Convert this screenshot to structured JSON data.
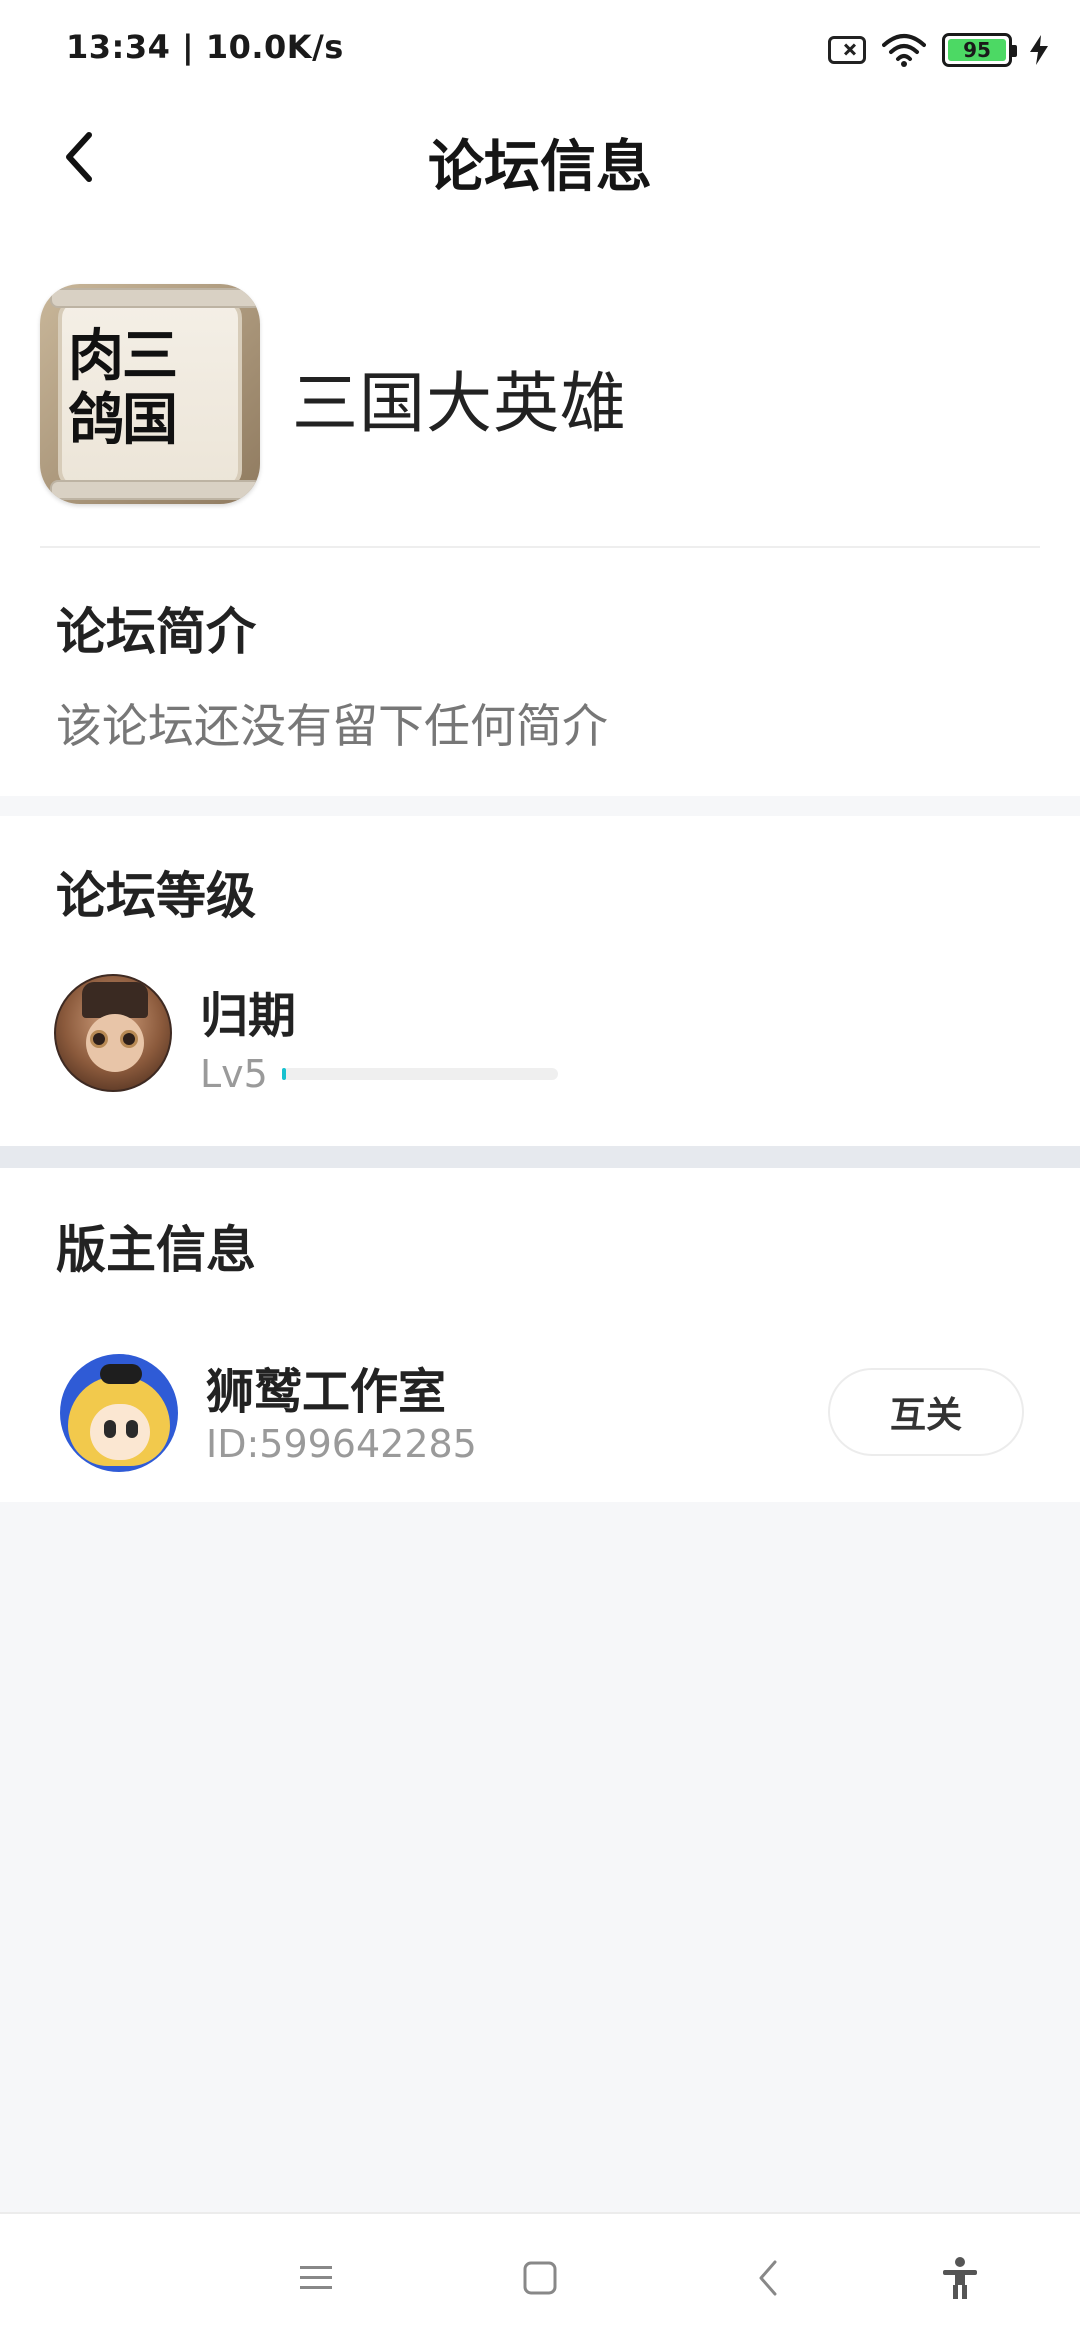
{
  "status_bar": {
    "time": "13:34 | 10.0K/s",
    "battery_level": "95",
    "icons": [
      "sim-no-signal-icon",
      "wifi-icon",
      "battery-icon",
      "charging-bolt-icon"
    ]
  },
  "header": {
    "title": "论坛信息",
    "back_icon": "chevron-left-icon"
  },
  "forum": {
    "logo_text": "肉三\n鸽国",
    "name": "三国大英雄"
  },
  "intro": {
    "title": "论坛简介",
    "text": "该论坛还没有留下任何简介"
  },
  "level": {
    "title": "论坛等级",
    "user_name": "归期",
    "level_label": "Lv5",
    "progress": 0.01
  },
  "moderator": {
    "title": "版主信息",
    "name": "狮鹫工作室",
    "id_text": "ID:599642285",
    "follow_label": "互关"
  },
  "nav": {
    "icons": [
      "menu-icon",
      "home-square-icon",
      "back-chevron-icon",
      "accessibility-icon"
    ]
  },
  "colors": {
    "accent": "#18c1cf",
    "battery": "#4cd964",
    "page_bg": "#f6f7f9"
  }
}
